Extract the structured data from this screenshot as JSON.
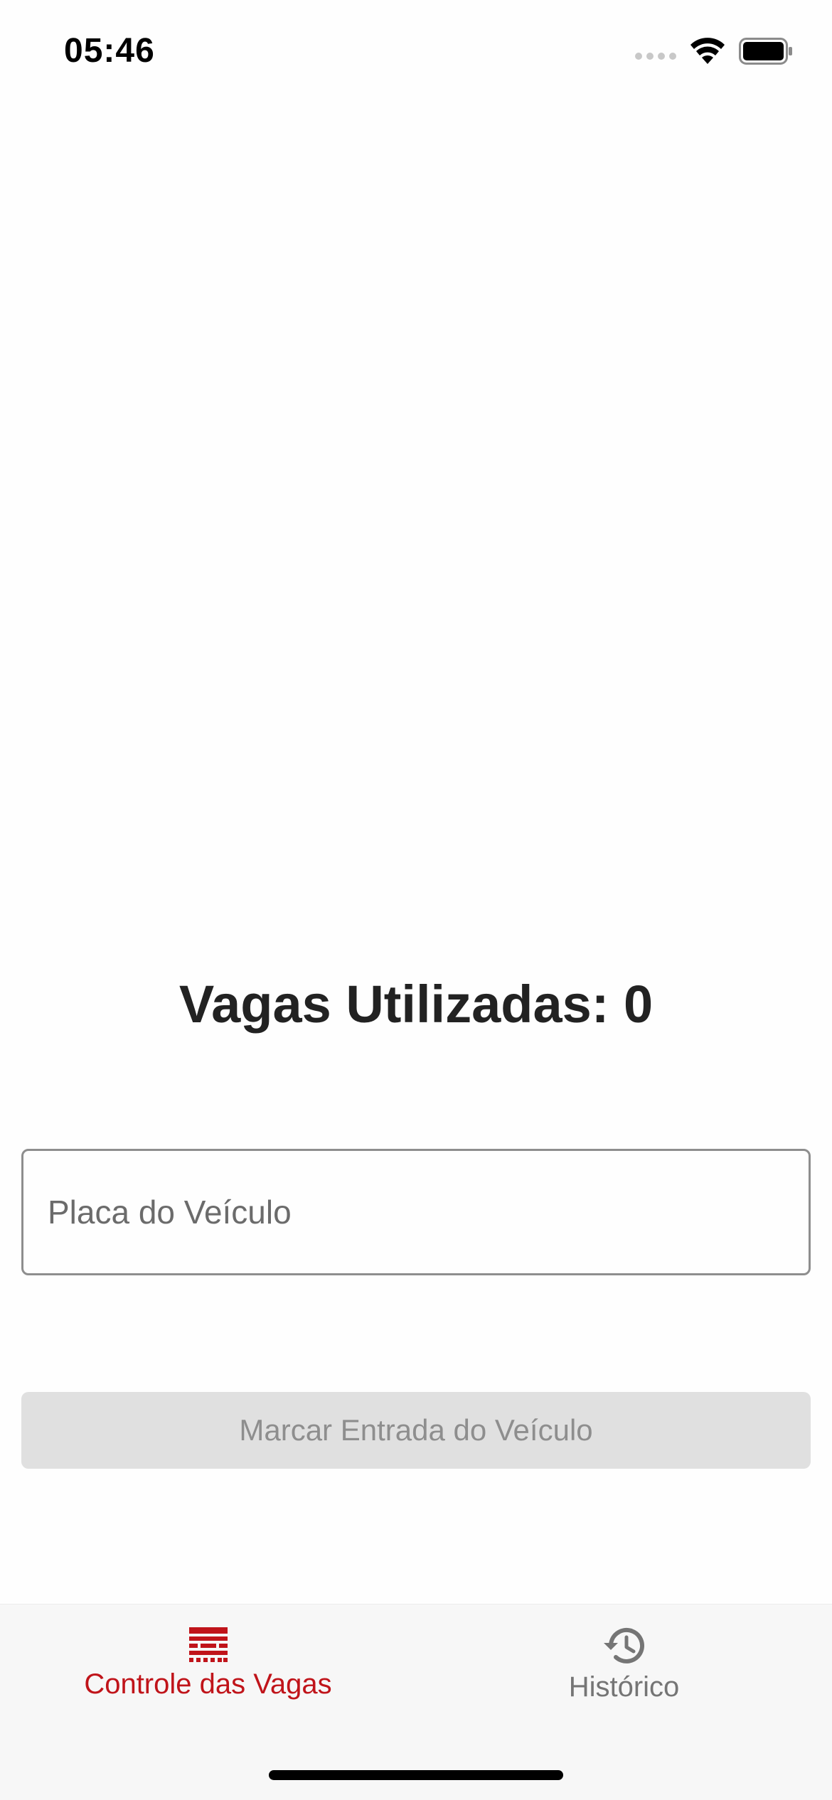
{
  "status_bar": {
    "time": "05:46",
    "icons": [
      "cellular-signal-icon",
      "wifi-icon",
      "battery-icon"
    ]
  },
  "main": {
    "counter_text": "Vagas Utilizadas: 0",
    "plate_input": {
      "placeholder": "Placa do Veículo",
      "value": ""
    },
    "entry_button_label": "Marcar Entrada do Veículo"
  },
  "tab_bar": {
    "tabs": [
      {
        "label": "Controle das Vagas",
        "icon": "parking-grid-icon",
        "active": true
      },
      {
        "label": "Histórico",
        "icon": "history-icon",
        "active": false
      }
    ]
  },
  "colors": {
    "accent": "#c0141a",
    "inactive_tab": "#757575",
    "disabled_button_bg": "#e0e0e0",
    "disabled_button_text": "#8e8e8e",
    "title_text": "#222222"
  }
}
